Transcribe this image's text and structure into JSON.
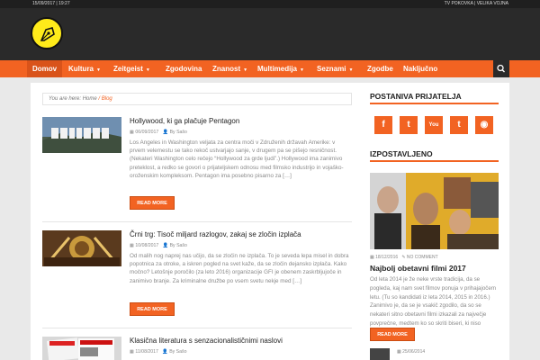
{
  "topbar": {
    "date": "15/09/2017 | 19:27",
    "links": "TV POKOVKA | VELIKA VOJNA"
  },
  "nav": {
    "items": [
      {
        "label": "Domov",
        "active": true
      },
      {
        "label": "Kultura",
        "dropdown": true
      },
      {
        "label": "Zeitgeist",
        "dropdown": true
      },
      {
        "label": "Zgodovina"
      },
      {
        "label": "Znanost",
        "dropdown": true
      },
      {
        "label": "Multimedija",
        "dropdown": true
      },
      {
        "label": "Seznami",
        "dropdown": true
      },
      {
        "label": "Zgodbe"
      },
      {
        "label": "Naključno"
      }
    ]
  },
  "breadcrumb": {
    "prefix": "You are here:",
    "home": "Home",
    "sep": "/",
    "current": "Blog"
  },
  "posts": [
    {
      "title": "Hollywood, ki ga plačuje Pentagon",
      "date": "06/09/2017",
      "author": "By Sašo",
      "excerpt": "Los Angeles in Washington veljata za centra moči v Združenih državah Amerike: v prvem velemestu se tako rekoč ustvarjajo sanje, v drugem pa se pišejo resničnost. (Nekateri Washington celo rečejo “Hollywood za grde ljudi”.) Hollywood ima zanimivo preteklost, a redko se govori o prijateljskem odnosu med filmsko industrijo in vojaško-oroženskim kompleksom. Pentagon ima posebno pisarno za […]",
      "more": "READ MORE"
    },
    {
      "title": "Črni trg: Tisoč miljard razlogov, zakaj se zločin izplača",
      "date": "10/08/2017",
      "author": "By Sašo",
      "excerpt": "Od malih nog naprej nas učijo, da se zločin ne izplača. To je seveda lepa misel in dobra popotnica za otroke, a iskren pogled na svet kaže, da se zločin dejansko izplača. Kako močno? Letošnje poročilo (za leto 2016) organizacije GFI je obenem zaskrbljujoče in zanimivo branje. Za kriminalne družbe po vsem svetu nekje med […]",
      "more": "READ MORE"
    },
    {
      "title": "Klasična literatura s senzacionalističnimi naslovi",
      "date": "11/08/2017",
      "author": "By Sašo"
    }
  ],
  "sidebar": {
    "friends_title": "POSTANIVA PRIJATELJA",
    "social": [
      {
        "icon": "facebook-icon",
        "glyph": "f"
      },
      {
        "icon": "twitter-icon",
        "glyph": "t"
      },
      {
        "icon": "youtube-icon",
        "glyph": "You"
      },
      {
        "icon": "tumblr-icon",
        "glyph": "t"
      },
      {
        "icon": "rss-icon",
        "glyph": "◉"
      }
    ],
    "featured_title": "IZPOSTAVLJENO",
    "featured": {
      "date": "18/12/2016",
      "comments": "NO COMMENT",
      "title": "Najbolj obetavni filmi 2017",
      "excerpt": "Od leta 2014 je že neke vrste tradicija, da se pogleda, kaj nam svet filmov ponuja v prihajajočem letu. (Tu so kandidati iz leta 2014, 2015 in 2016.) Zanimivo je, da se je vsakič zgodilo, da so se nekateri sitno obetavni filmi izkazali za največje povprečne, medtem ko so skriti biseri, ki niso kazali…",
      "more": "READ MORE"
    },
    "next": {
      "date": "25/06/2014"
    }
  },
  "colors": {
    "accent": "#f26322",
    "header": "#2a2a2a",
    "logo": "#ffeb1a"
  }
}
